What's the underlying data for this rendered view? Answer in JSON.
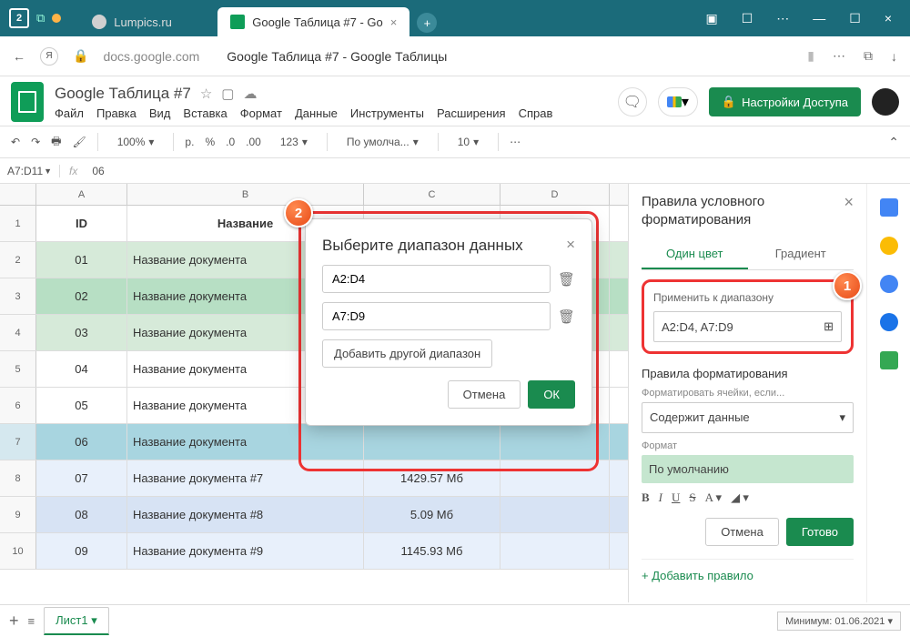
{
  "window": {
    "tab1": "Lumpics.ru",
    "tab2": "Google Таблица #7 - Go",
    "house_num": "2"
  },
  "addr": {
    "url": "docs.google.com",
    "title": "Google Таблица #7 - Google Таблицы"
  },
  "doc": {
    "name": "Google Таблица #7",
    "menus": [
      "Файл",
      "Правка",
      "Вид",
      "Вставка",
      "Формат",
      "Данные",
      "Инструменты",
      "Расширения",
      "Справ"
    ],
    "share": "Настройки Доступа"
  },
  "toolbar": {
    "zoom": "100%",
    "currency": "р.",
    "percent": "%",
    "dec_dec": ".0",
    "dec_inc": ".00",
    "num": "123",
    "font": "По умолча...",
    "size": "10"
  },
  "namebox": {
    "ref": "A7:D11",
    "fx": "fx",
    "val": "06"
  },
  "columns": [
    "A",
    "B",
    "C",
    "D"
  ],
  "rows": [
    {
      "n": "1",
      "cls": "hdr",
      "a": "ID",
      "b": "Название",
      "c": "",
      "d": ""
    },
    {
      "n": "2",
      "cls": "g1",
      "a": "01",
      "b": "Название документа",
      "c": "",
      "d": ""
    },
    {
      "n": "3",
      "cls": "g2",
      "a": "02",
      "b": "Название документа",
      "c": "",
      "d": ""
    },
    {
      "n": "4",
      "cls": "g1",
      "a": "03",
      "b": "Название документа",
      "c": "",
      "d": ""
    },
    {
      "n": "5",
      "cls": "",
      "a": "04",
      "b": "Название документа",
      "c": "",
      "d": ""
    },
    {
      "n": "6",
      "cls": "",
      "a": "05",
      "b": "Название документа",
      "c": "",
      "d": ""
    },
    {
      "n": "7",
      "cls": "sel",
      "a": "06",
      "b": "Название документа",
      "c": "",
      "d": ""
    },
    {
      "n": "8",
      "cls": "blue",
      "a": "07",
      "b": "Название документа #7",
      "c": "1429.57 Мб",
      "d": ""
    },
    {
      "n": "9",
      "cls": "lbl",
      "a": "08",
      "b": "Название документа #8",
      "c": "5.09 Мб",
      "d": ""
    },
    {
      "n": "10",
      "cls": "blue",
      "a": "09",
      "b": "Название документа #9",
      "c": "1145.93 Мб",
      "d": ""
    }
  ],
  "side": {
    "title": "Правила условного форматирования",
    "tab1": "Один цвет",
    "tab2": "Градиент",
    "range_label": "Применить к диапазону",
    "range_value": "A2:D4, A7:D9",
    "rules_title": "Правила форматирования",
    "cond_label": "Форматировать ячейки, если...",
    "cond_value": "Содержит данные",
    "fmt_label": "Формат",
    "fmt_preview": "По умолчанию",
    "cancel": "Отмена",
    "done": "Готово",
    "add_rule": "+  Добавить правило"
  },
  "dialog": {
    "title": "Выберите диапазон данных",
    "r1": "A2:D4",
    "r2": "A7:D9",
    "add": "Добавить другой диапазон",
    "cancel": "Отмена",
    "ok": "ОК"
  },
  "sheetbar": {
    "tab": "Лист1",
    "filter": "Минимум: 01.06.2021"
  },
  "badges": {
    "b1": "1",
    "b2": "2"
  }
}
